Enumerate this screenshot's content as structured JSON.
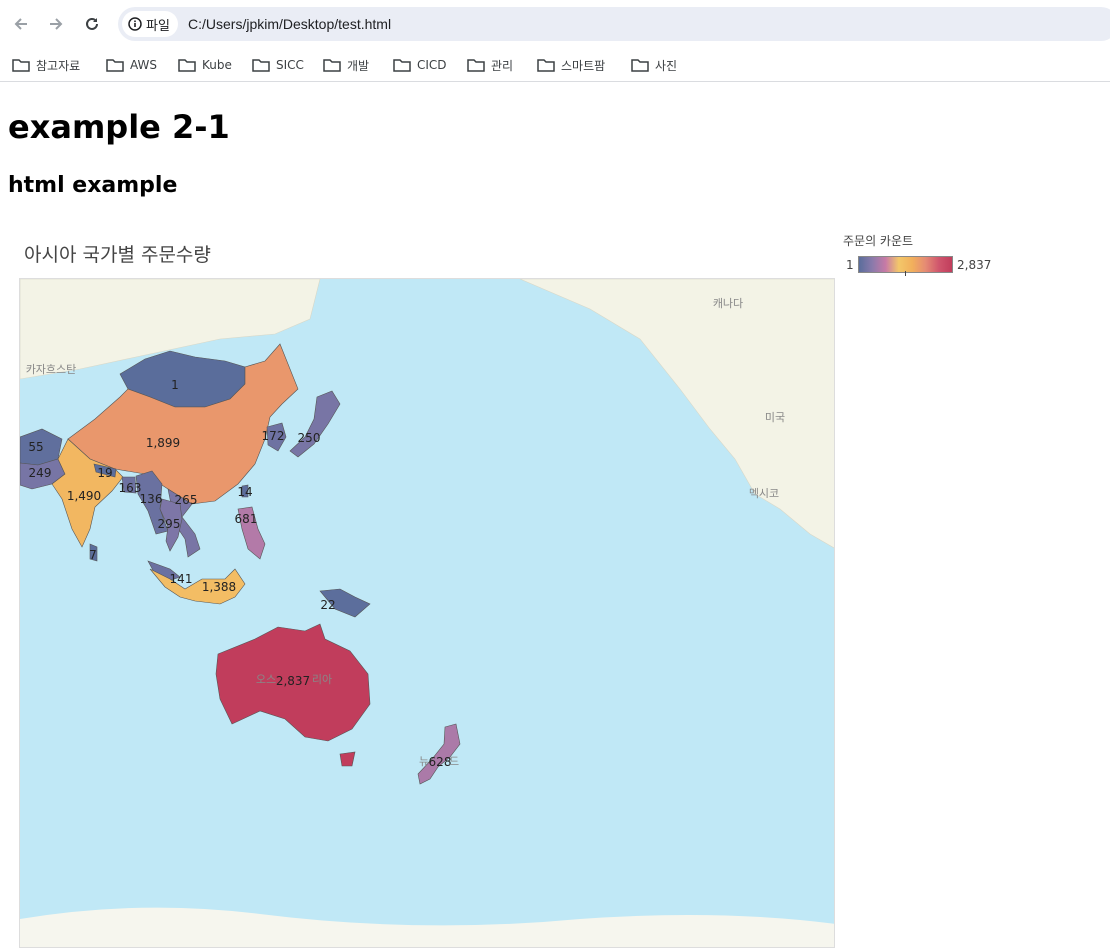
{
  "browser": {
    "chip_label": "파일",
    "url": "C:/Users/jpkim/Desktop/test.html",
    "bookmarks": [
      "참고자료",
      "AWS",
      "Kube",
      "SICC",
      "개발",
      "CICD",
      "관리",
      "스마트팜",
      "사진"
    ]
  },
  "page": {
    "h1": "example 2-1",
    "h2": "html example"
  },
  "chart_data": {
    "type": "choropleth-map",
    "title": "아시아 국가별 주문수량",
    "colorbar": {
      "title": "주문의 카운트",
      "min_label": "1",
      "max_label": "2,837",
      "colors": [
        "#5a6d9b",
        "#8a7aab",
        "#c77aa6",
        "#f3c76a",
        "#f2b05c",
        "#e58b74",
        "#d0566d",
        "#c13d5c"
      ]
    },
    "values": [
      {
        "label": "1",
        "value": 1
      },
      {
        "label": "1,899",
        "value": 1899
      },
      {
        "label": "172",
        "value": 172
      },
      {
        "label": "250",
        "value": 250
      },
      {
        "label": "55",
        "value": 55
      },
      {
        "label": "249",
        "value": 249
      },
      {
        "label": "1,490",
        "value": 1490
      },
      {
        "label": "19",
        "value": 19
      },
      {
        "label": "163",
        "value": 163
      },
      {
        "label": "136",
        "value": 136
      },
      {
        "label": "265",
        "value": 265
      },
      {
        "label": "14",
        "value": 14
      },
      {
        "label": "295",
        "value": 295
      },
      {
        "label": "681",
        "value": 681
      },
      {
        "label": "7",
        "value": 7
      },
      {
        "label": "141",
        "value": 141
      },
      {
        "label": "1,388",
        "value": 1388
      },
      {
        "label": "22",
        "value": 22
      },
      {
        "label": "2,837",
        "value": 2837
      },
      {
        "label": "628",
        "value": 628
      }
    ],
    "map_labels": [
      "카자흐스탄",
      "캐나다",
      "미국",
      "멕시코",
      "오스",
      "리아",
      "뉴",
      "드"
    ]
  }
}
